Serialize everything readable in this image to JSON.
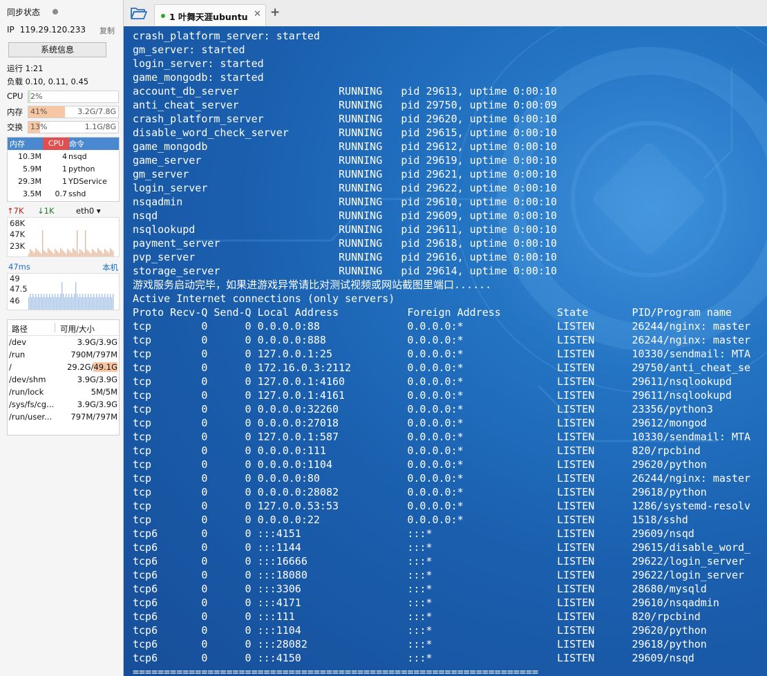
{
  "sidebar": {
    "sync_label": "同步状态",
    "ip_label": "IP",
    "ip": "119.29.120.233",
    "copy_label": "复制",
    "sysinfo_button": "系统信息",
    "uptime": "运行 1:21",
    "load": "负载 0.10, 0.11, 0.45",
    "meters": {
      "cpu": {
        "label": "CPU",
        "pct": "2%",
        "fraction": 0.02,
        "amount": ""
      },
      "mem": {
        "label": "内存",
        "pct": "41%",
        "fraction": 0.41,
        "amount": "3.2G/7.8G"
      },
      "swap": {
        "label": "交换",
        "pct": "13%",
        "fraction": 0.13,
        "amount": "1.1G/8G"
      }
    },
    "proc_headers": [
      "内存",
      "CPU",
      "命令"
    ],
    "procs": [
      {
        "mem": "10.3M",
        "cpu": "4",
        "name": "nsqd"
      },
      {
        "mem": "5.9M",
        "cpu": "1",
        "name": "python"
      },
      {
        "mem": "29.3M",
        "cpu": "1",
        "name": "YDService"
      },
      {
        "mem": "3.5M",
        "cpu": "0.7",
        "name": "sshd"
      }
    ],
    "net": {
      "up": "7K",
      "down": "1K",
      "interface": "eth0",
      "y_ticks": [
        "68K",
        "47K",
        "23K"
      ]
    },
    "ping": {
      "value": "47ms",
      "host": "本机",
      "y_ticks": [
        "49",
        "47.5",
        "46"
      ]
    },
    "disk_headers": {
      "path": "路径",
      "size": "可用/大小"
    },
    "disks": [
      {
        "path": "/dev",
        "used": "3.9G",
        "size": "3.9G"
      },
      {
        "path": "/run",
        "used": "790M",
        "size": "797M"
      },
      {
        "path": "/",
        "used": "29.2G",
        "size": "49.1G"
      },
      {
        "path": "/dev/shm",
        "used": "3.9G",
        "size": "3.9G"
      },
      {
        "path": "/run/lock",
        "used": "5M",
        "size": "5M"
      },
      {
        "path": "/sys/fs/cg...",
        "used": "3.9G",
        "size": "3.9G"
      },
      {
        "path": "/run/user...",
        "used": "797M",
        "size": "797M"
      }
    ]
  },
  "tabs": [
    {
      "label": "1 叶舞天涯ubuntu",
      "active": true
    }
  ],
  "icons": {
    "open": "folder-open-icon",
    "close": "close-icon",
    "add": "plus-icon"
  },
  "colors": {
    "terminal_bg": "#1a5fae",
    "accent": "#4a88d0",
    "cpu_header": "#e05050",
    "mem_fill": "#f7c7a3"
  },
  "terminal": {
    "lines": [
      "crash_platform_server: started",
      "gm_server: started",
      "login_server: started",
      "game_mongodb: started",
      "account_db_server                RUNNING   pid 29613, uptime 0:00:10",
      "anti_cheat_server                RUNNING   pid 29750, uptime 0:00:09",
      "crash_platform_server            RUNNING   pid 29620, uptime 0:00:10",
      "disable_word_check_server        RUNNING   pid 29615, uptime 0:00:10",
      "game_mongodb                     RUNNING   pid 29612, uptime 0:00:10",
      "game_server                      RUNNING   pid 29619, uptime 0:00:10",
      "gm_server                        RUNNING   pid 29621, uptime 0:00:10",
      "login_server                     RUNNING   pid 29622, uptime 0:00:10",
      "nsqadmin                         RUNNING   pid 29610, uptime 0:00:10",
      "nsqd                             RUNNING   pid 29609, uptime 0:00:10",
      "nsqlookupd                       RUNNING   pid 29611, uptime 0:00:10",
      "payment_server                   RUNNING   pid 29618, uptime 0:00:10",
      "pvp_server                       RUNNING   pid 29616, uptime 0:00:10",
      "storage_server                   RUNNING   pid 29614, uptime 0:00:10",
      "游戏服务启动完毕，如果进游戏异常请比对测试视频或网站截图里端口......",
      "Active Internet connections (only servers)",
      "Proto Recv-Q Send-Q Local Address           Foreign Address         State       PID/Program name",
      "tcp        0      0 0.0.0.0:88              0.0.0.0:*               LISTEN      26244/nginx: master",
      "tcp        0      0 0.0.0.0:888             0.0.0.0:*               LISTEN      26244/nginx: master",
      "tcp        0      0 127.0.0.1:25            0.0.0.0:*               LISTEN      10330/sendmail: MTA",
      "tcp        0      0 172.16.0.3:2112         0.0.0.0:*               LISTEN      29750/anti_cheat_se",
      "tcp        0      0 127.0.0.1:4160          0.0.0.0:*               LISTEN      29611/nsqlookupd",
      "tcp        0      0 127.0.0.1:4161          0.0.0.0:*               LISTEN      29611/nsqlookupd",
      "tcp        0      0 0.0.0.0:32260           0.0.0.0:*               LISTEN      23356/python3",
      "tcp        0      0 0.0.0.0:27018           0.0.0.0:*               LISTEN      29612/mongod",
      "tcp        0      0 127.0.0.1:587           0.0.0.0:*               LISTEN      10330/sendmail: MTA",
      "tcp        0      0 0.0.0.0:111             0.0.0.0:*               LISTEN      820/rpcbind",
      "tcp        0      0 0.0.0.0:1104            0.0.0.0:*               LISTEN      29620/python",
      "tcp        0      0 0.0.0.0:80              0.0.0.0:*               LISTEN      26244/nginx: master",
      "tcp        0      0 0.0.0.0:28082           0.0.0.0:*               LISTEN      29618/python",
      "tcp        0      0 127.0.0.53:53           0.0.0.0:*               LISTEN      1286/systemd-resolv",
      "tcp        0      0 0.0.0.0:22              0.0.0.0:*               LISTEN      1518/sshd",
      "tcp6       0      0 :::4151                 :::*                    LISTEN      29609/nsqd",
      "tcp6       0      0 :::1144                 :::*                    LISTEN      29615/disable_word_",
      "tcp6       0      0 :::16666                :::*                    LISTEN      29622/login_server",
      "tcp6       0      0 :::18080                :::*                    LISTEN      29622/login_server",
      "tcp6       0      0 :::3306                 :::*                    LISTEN      28680/mysqld",
      "tcp6       0      0 :::4171                 :::*                    LISTEN      29610/nsqadmin",
      "tcp6       0      0 :::111                  :::*                    LISTEN      820/rpcbind",
      "tcp6       0      0 :::1104                 :::*                    LISTEN      29620/python",
      "tcp6       0      0 :::28082                :::*                    LISTEN      29618/python",
      "tcp6       0      0 :::4150                 :::*                    LISTEN      29609/nsqd",
      "================================================================="
    ]
  }
}
